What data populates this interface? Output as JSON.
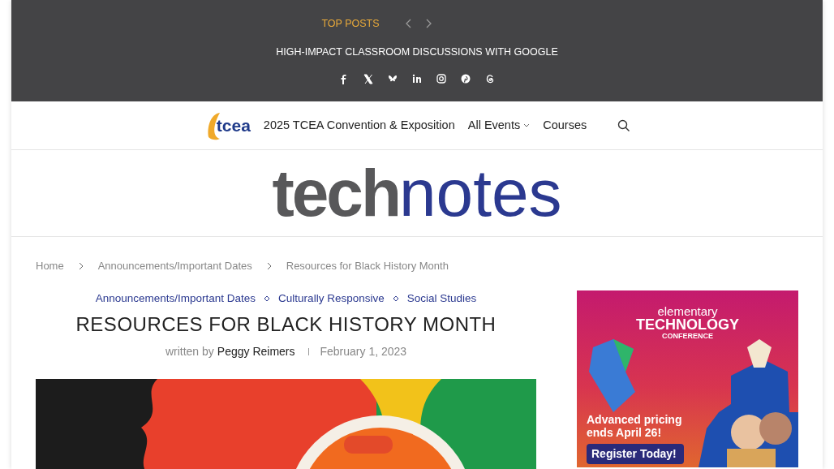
{
  "top_bar": {
    "label": "TOP POSTS",
    "headline": "HIGH-IMPACT CLASSROOM DISCUSSIONS WITH GOOGLE"
  },
  "nav": {
    "logo_text": "tcea",
    "items": [
      {
        "label": "2025 TCEA Convention & Exposition",
        "dropdown": false
      },
      {
        "label": "All Events",
        "dropdown": true
      },
      {
        "label": "Courses",
        "dropdown": false
      }
    ]
  },
  "site_logo": {
    "part_1": "tech",
    "part_2": "notes"
  },
  "breadcrumb": [
    "Home",
    "Announcements/Important Dates",
    "Resources for Black History Month"
  ],
  "article": {
    "categories": [
      "Announcements/Important Dates",
      "Culturally Responsive",
      "Social Studies"
    ],
    "title": "RESOURCES FOR BLACK HISTORY MONTH",
    "byline_prefix": "written by",
    "author": "Peggy Reimers",
    "date": "February 1, 2023"
  },
  "ad": {
    "line_1": "elementary",
    "line_2": "TECHNOLOGY",
    "line_3": "CONFERENCE",
    "offer": "Advanced pricing ends April 26!",
    "button": "Register Today!"
  }
}
